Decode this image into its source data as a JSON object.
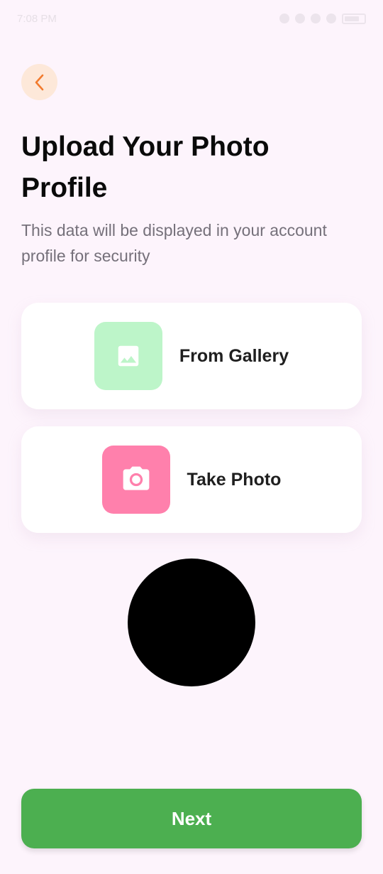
{
  "status_bar": {
    "time": "7:08 PM"
  },
  "header": {
    "back_icon": "chevron-left-icon",
    "title": "Upload Your Photo Profile",
    "subtitle": "This data will be displayed in your account profile for security"
  },
  "options": [
    {
      "label": "From Gallery",
      "icon": "image-icon",
      "color": "#bdf5c9"
    },
    {
      "label": "Take Photo",
      "icon": "camera-icon",
      "color": "#ff80ac"
    }
  ],
  "footer": {
    "next_label": "Next",
    "accent": "#4caf50"
  }
}
